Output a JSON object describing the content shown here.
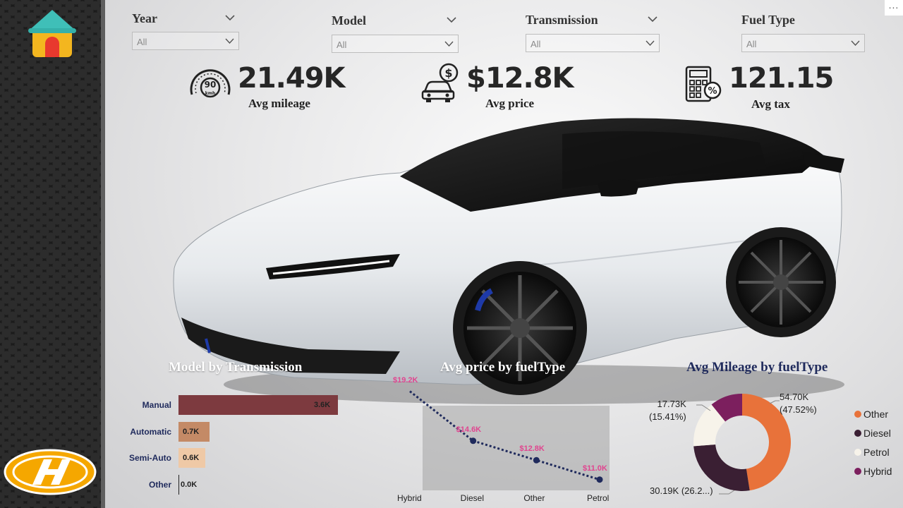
{
  "sidebar": {
    "home_icon": "home-icon",
    "brand_logo": "hyundai-logo"
  },
  "toolbar": {
    "more_label": "..."
  },
  "filters": [
    {
      "title": "Year",
      "value": "All"
    },
    {
      "title": "Model",
      "value": "All"
    },
    {
      "title": "Transmission",
      "value": "All"
    },
    {
      "title": "Fuel Type",
      "value": "All"
    }
  ],
  "kpis": [
    {
      "value": "21.49K",
      "label": "Avg mileage",
      "icon": "speedometer-icon",
      "icon_text": "90",
      "icon_unit": "kmh"
    },
    {
      "value": "$12.8K",
      "label": "Avg price",
      "icon": "car-dollar-icon"
    },
    {
      "value": "121.15",
      "label": "Avg tax",
      "icon": "tax-calculator-icon"
    }
  ],
  "colors": {
    "bar_manual": "#7d3a3f",
    "bar_automatic": "#c48a66",
    "bar_semiauto": "#efc9a6",
    "line": "#1f2a5c",
    "point_label": "#e0458f",
    "donut_other": "#e8723a",
    "donut_diesel": "#3a1f33",
    "donut_petrol": "#f7f3ea",
    "donut_hybrid": "#7c1f5e"
  },
  "charts": {
    "model_by_transmission": {
      "title": "Model by Transmission"
    },
    "avg_price_by_fueltype": {
      "title": "Avg price by fuelType"
    },
    "avg_mileage_by_fueltype": {
      "title": "Avg Mileage by fuelType"
    }
  },
  "chart_data": [
    {
      "type": "bar",
      "orientation": "horizontal",
      "title": "Model by Transmission",
      "categories": [
        "Manual",
        "Automatic",
        "Semi-Auto",
        "Other"
      ],
      "values": [
        3600,
        700,
        600,
        0
      ],
      "value_labels": [
        "3.6K",
        "0.7K",
        "0.6K",
        "0.0K"
      ]
    },
    {
      "type": "line",
      "title": "Avg price by fuelType",
      "categories": [
        "Hybrid",
        "Diesel",
        "Other",
        "Petrol"
      ],
      "values": [
        19200,
        14600,
        12800,
        11000
      ],
      "value_labels": [
        "$19.2K",
        "$14.6K",
        "$12.8K",
        "$11.0K"
      ]
    },
    {
      "type": "pie",
      "donut": true,
      "title": "Avg Mileage by fuelType",
      "categories": [
        "Other",
        "Diesel",
        "Petrol",
        "Hybrid"
      ],
      "values": [
        54.7,
        30.19,
        17.73,
        12.49
      ],
      "slice_labels": [
        {
          "line1": "54.70K",
          "line2": "(47.52%)"
        },
        {
          "line1": "30.19K (26.2...)",
          "line2": ""
        },
        {
          "line1": "17.73K",
          "line2": "(15.41%)"
        }
      ],
      "legend": [
        "Other",
        "Diesel",
        "Petrol",
        "Hybrid"
      ],
      "legend_position": "right"
    }
  ]
}
